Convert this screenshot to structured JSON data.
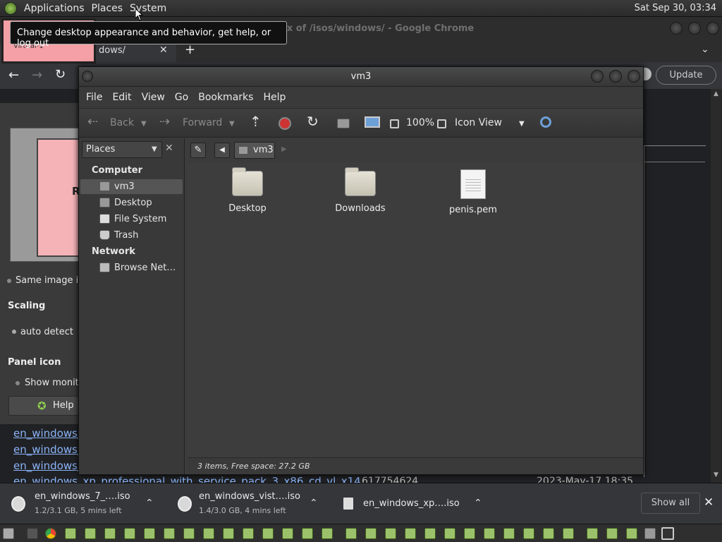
{
  "top_panel": {
    "menus": [
      "Applications",
      "Places",
      "System"
    ],
    "clock": "Sat Sep 30, 03:34"
  },
  "tooltip": "Change desktop appearance and behavior, get help, or log out",
  "chrome": {
    "title_fragment": "ex of /isos/windows/ - Google Chrome",
    "tab_fragment": "dows/",
    "update_label": "Update",
    "thumb_label": "Virtual-1"
  },
  "settings_panel": {
    "preview_letter": "R",
    "same_image": "Same image in",
    "scaling_label": "Scaling",
    "auto_detect": "auto detect",
    "panel_icon_label": "Panel icon",
    "show_monitor": "Show monito",
    "help_label": "Help"
  },
  "links": [
    "en_windows_",
    "en_windows_",
    "en_windows_"
  ],
  "hidden_row": {
    "name": "en_windows_xp_professional_with_service_pack_3_x86_cd_vl_x14",
    "size": "617754624",
    "date": "2023-May-17 18:35"
  },
  "nautilus": {
    "title": "vm3",
    "menus": [
      "File",
      "Edit",
      "View",
      "Go",
      "Bookmarks",
      "Help"
    ],
    "toolbar": {
      "back": "Back",
      "forward": "Forward",
      "zoom": "100%",
      "view_mode": "Icon View"
    },
    "sidebar": {
      "combo": "Places",
      "computer_header": "Computer",
      "computer_items": [
        "vm3",
        "Desktop",
        "File System",
        "Trash"
      ],
      "network_header": "Network",
      "network_items": [
        "Browse Net…"
      ]
    },
    "path": "vm3",
    "files": [
      {
        "name": "Desktop",
        "kind": "folder"
      },
      {
        "name": "Downloads",
        "kind": "folder"
      },
      {
        "name": "penis.pem",
        "kind": "file"
      }
    ],
    "status": "3 items, Free space: 27.2 GB"
  },
  "downloads": [
    {
      "name": "en_windows_7_….iso",
      "status": "1.2/3.1 GB, 5 mins left"
    },
    {
      "name": "en_windows_vist….iso",
      "status": "1.4/3.0 GB, 4 mins left"
    },
    {
      "name": "en_windows_xp….iso",
      "status": ""
    }
  ],
  "shelf": {
    "show_all": "Show all"
  }
}
